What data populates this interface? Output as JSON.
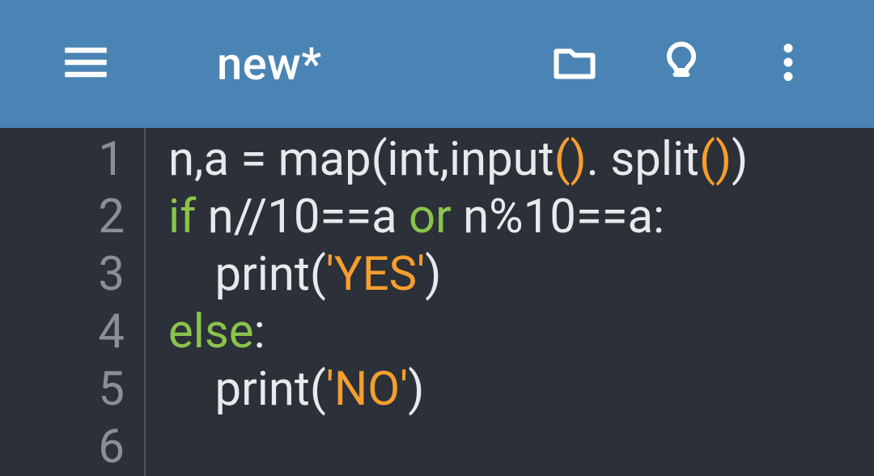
{
  "header": {
    "title": "new*"
  },
  "editor": {
    "line_numbers": [
      "1",
      "2",
      "3",
      "4",
      "5",
      "6"
    ],
    "lines": [
      [
        {
          "cls": "tok-plain",
          "t": "n,a = map(int,input"
        },
        {
          "cls": "tok-par",
          "t": "()"
        },
        {
          "cls": "tok-plain",
          "t": ". split"
        },
        {
          "cls": "tok-par",
          "t": "()"
        },
        {
          "cls": "tok-plain",
          "t": ")"
        }
      ],
      [
        {
          "cls": "tok-kw",
          "t": "if"
        },
        {
          "cls": "tok-plain",
          "t": " n//10==a "
        },
        {
          "cls": "tok-kw",
          "t": "or"
        },
        {
          "cls": "tok-plain",
          "t": " n%10==a:"
        }
      ],
      [
        {
          "cls": "tok-plain",
          "t": "    print("
        },
        {
          "cls": "tok-str",
          "t": "'YES'"
        },
        {
          "cls": "tok-plain",
          "t": ")"
        }
      ],
      [
        {
          "cls": "tok-kw",
          "t": "else"
        },
        {
          "cls": "tok-plain",
          "t": ":"
        }
      ],
      [
        {
          "cls": "tok-plain",
          "t": "    print("
        },
        {
          "cls": "tok-str",
          "t": "'NO'"
        },
        {
          "cls": "tok-plain",
          "t": ")"
        }
      ],
      [
        {
          "cls": "tok-plain",
          "t": ""
        }
      ]
    ]
  }
}
